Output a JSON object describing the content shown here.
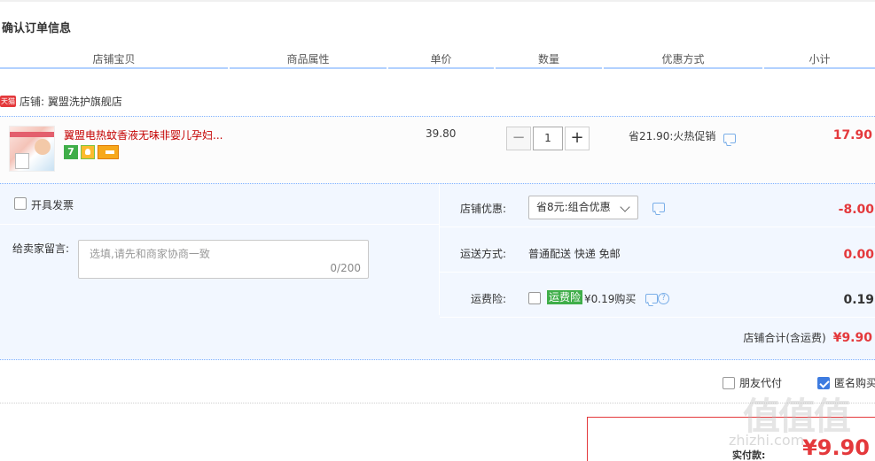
{
  "page": {
    "title": "确认订单信息"
  },
  "columns": [
    "店铺宝贝",
    "商品属性",
    "单价",
    "数量",
    "优惠方式",
    "小计"
  ],
  "shop": {
    "badge": "天猫",
    "label": "店铺: 翼盟洗护旗舰店"
  },
  "item": {
    "name": "翼盟电热蚊香液无味非婴儿孕妇...",
    "service_icons": [
      "seven-day-return-icon",
      "gold-guarantee-icon",
      "credit-card-icon"
    ],
    "unit_price": "39.80",
    "quantity": "1",
    "minus_label": "−",
    "plus_label": "+",
    "promo": "省21.90:火热促销",
    "subtotal": "17.90"
  },
  "invoice": {
    "label": "开具发票"
  },
  "message": {
    "label": "给卖家留言:",
    "placeholder": "选填,请先和商家协商一致",
    "counter": "0/200"
  },
  "store_coupon": {
    "label": "店铺优惠:",
    "selected": "省8元:组合优惠",
    "value": "-8.00"
  },
  "shipping": {
    "label": "运送方式:",
    "method": "普通配送 快递 免邮",
    "value": "0.00"
  },
  "insurance": {
    "label": "运费险:",
    "badge": "运费险",
    "price": "¥0.19购买",
    "help": "?",
    "value": "0.19"
  },
  "shop_total": {
    "label": "店铺合计(含运费)",
    "value": "¥9.90"
  },
  "options": {
    "friend_pay": "朋友代付",
    "anonymous": "匿名购买"
  },
  "payment": {
    "label": "实付款:",
    "value": "¥9.90"
  },
  "watermark": {
    "main": "值值值",
    "sub": "zhizhi.com"
  },
  "colors": {
    "accent": "#e4393c",
    "link": "#3e7ce0",
    "panel": "#f2f7ff",
    "border_blue": "#b2d1ff"
  }
}
